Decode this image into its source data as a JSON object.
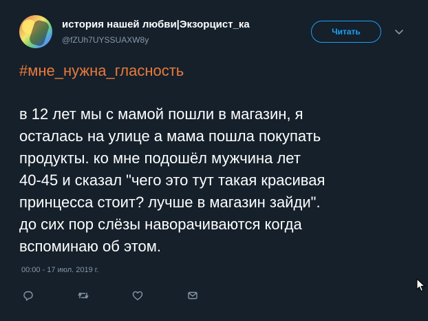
{
  "author": {
    "name": "история нашей любви|Экзорцист_ка",
    "handle": "@fZUh7UYSSUAXW8y"
  },
  "follow_button": {
    "label": "Читать"
  },
  "tweet": {
    "hashtag": "#мне_нужна_гласность",
    "lines": [
      "в 12 лет мы с мамой пошли в магазин, я",
      "осталась на улице а мама пошла покупать",
      "продукты. ко мне подошёл мужчина лет",
      "40-45 и сказал \"чего это тут такая красивая",
      "принцесса стоит? лучше в магазин зайди\".",
      "до сих пор слёзы наворачиваются когда",
      "вспоминаю об этом."
    ],
    "timestamp": "00:00 - 17 июл. 2019 г."
  },
  "actions": [
    {
      "icon": "reply-icon"
    },
    {
      "icon": "retweet-icon"
    },
    {
      "icon": "like-icon"
    },
    {
      "icon": "direct-message-icon"
    }
  ],
  "colors": {
    "background": "#15202b",
    "text": "#ffffff",
    "secondary_text": "#8899a6",
    "accent": "#1da1f2",
    "hashtag": "#ea7a3a"
  }
}
